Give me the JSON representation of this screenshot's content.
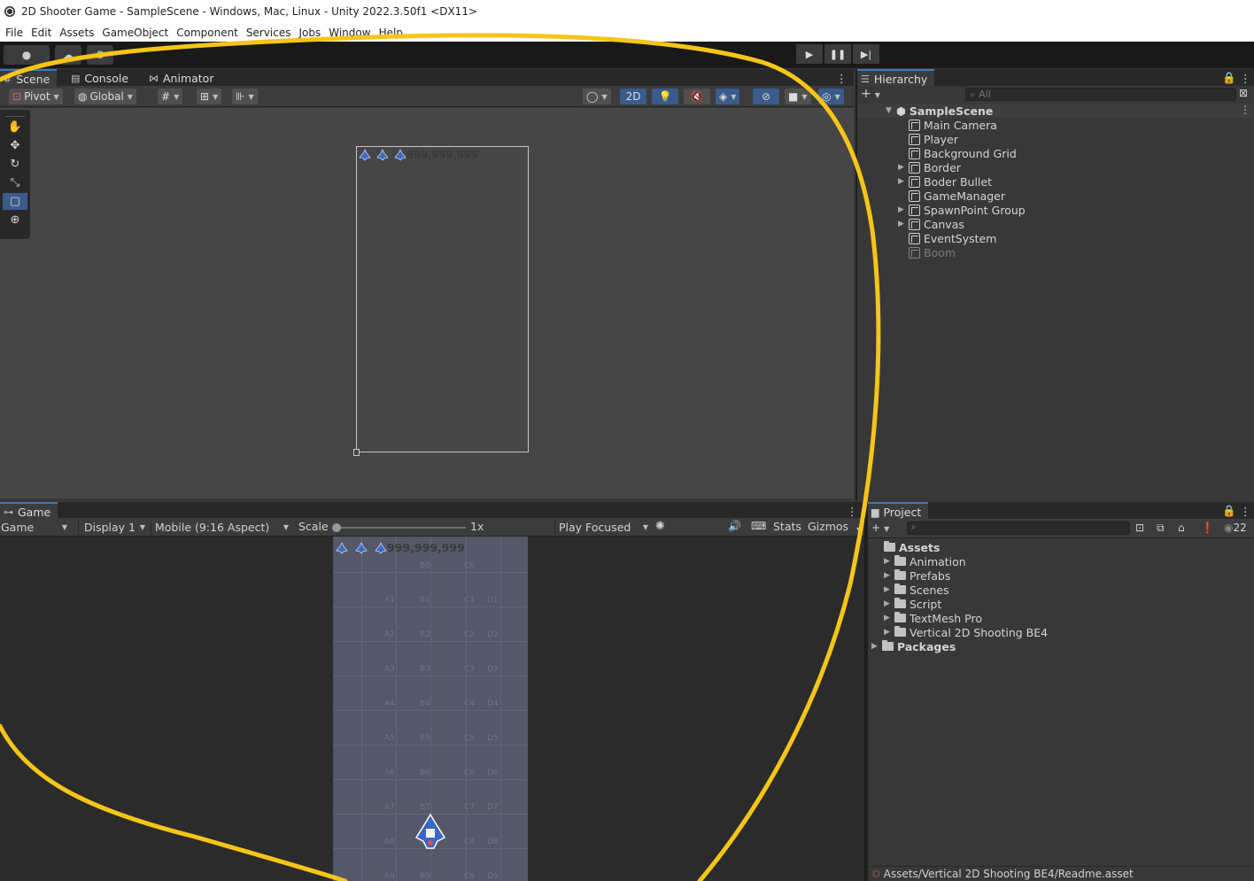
{
  "window": {
    "title": "2D Shooter Game - SampleScene - Windows, Mac, Linux - Unity 2022.3.50f1 <DX11>"
  },
  "menu": [
    "File",
    "Edit",
    "Assets",
    "GameObject",
    "Component",
    "Services",
    "Jobs",
    "Window",
    "Help"
  ],
  "scene_panel": {
    "tabs": [
      "Scene",
      "Console",
      "Animator"
    ],
    "pivot": "Pivot",
    "global": "Global",
    "mode_2d": "2D",
    "score_text": "999,999,999"
  },
  "hierarchy": {
    "tab": "Hierarchy",
    "search_placeholder": "All",
    "scene_name": "SampleScene",
    "items": [
      {
        "label": "Main Camera",
        "expandable": false,
        "dim": false
      },
      {
        "label": "Player",
        "expandable": false,
        "dim": false
      },
      {
        "label": "Background Grid",
        "expandable": false,
        "dim": false
      },
      {
        "label": "Border",
        "expandable": true,
        "dim": false
      },
      {
        "label": "Boder Bullet",
        "expandable": true,
        "dim": false
      },
      {
        "label": "GameManager",
        "expandable": false,
        "dim": false
      },
      {
        "label": "SpawnPoint Group",
        "expandable": true,
        "dim": false
      },
      {
        "label": "Canvas",
        "expandable": true,
        "dim": false
      },
      {
        "label": "EventSystem",
        "expandable": false,
        "dim": false
      },
      {
        "label": "Boom",
        "expandable": false,
        "dim": true
      }
    ]
  },
  "game_panel": {
    "tab": "Game",
    "view_select": "Game",
    "display": "Display 1",
    "aspect": "Mobile (9:16 Aspect)",
    "scale_label": "Scale",
    "scale_value": "1x",
    "play_focused": "Play Focused",
    "stats": "Stats",
    "gizmos": "Gizmos",
    "score_text": "999,999,999",
    "grid_rows": [
      [
        "B0",
        "C0"
      ],
      [
        "A1",
        "B1",
        "C1",
        "D1"
      ],
      [
        "A2",
        "B2",
        "C2",
        "D2"
      ],
      [
        "A3",
        "B3",
        "C3",
        "D3"
      ],
      [
        "A4",
        "B4",
        "C4",
        "D4"
      ],
      [
        "A5",
        "B5",
        "C5",
        "D5"
      ],
      [
        "A6",
        "B6",
        "C6",
        "D6"
      ],
      [
        "A7",
        "B7",
        "C7",
        "D7"
      ],
      [
        "A8",
        "B8",
        "C8",
        "D8"
      ],
      [
        "A9",
        "B9",
        "C9",
        "D9"
      ]
    ]
  },
  "project": {
    "tab": "Project",
    "hidden_count": "22",
    "root": "Assets",
    "folders": [
      "Animation",
      "Prefabs",
      "Scenes",
      "Script",
      "TextMesh Pro",
      "Vertical 2D Shooting BE4"
    ],
    "packages": "Packages",
    "status_path": "Assets/Vertical 2D Shooting BE4/Readme.asset"
  },
  "colors": {
    "accent": "#3a79bb",
    "selected_tool": "#3a5b8c",
    "annotation": "#f5c518"
  }
}
